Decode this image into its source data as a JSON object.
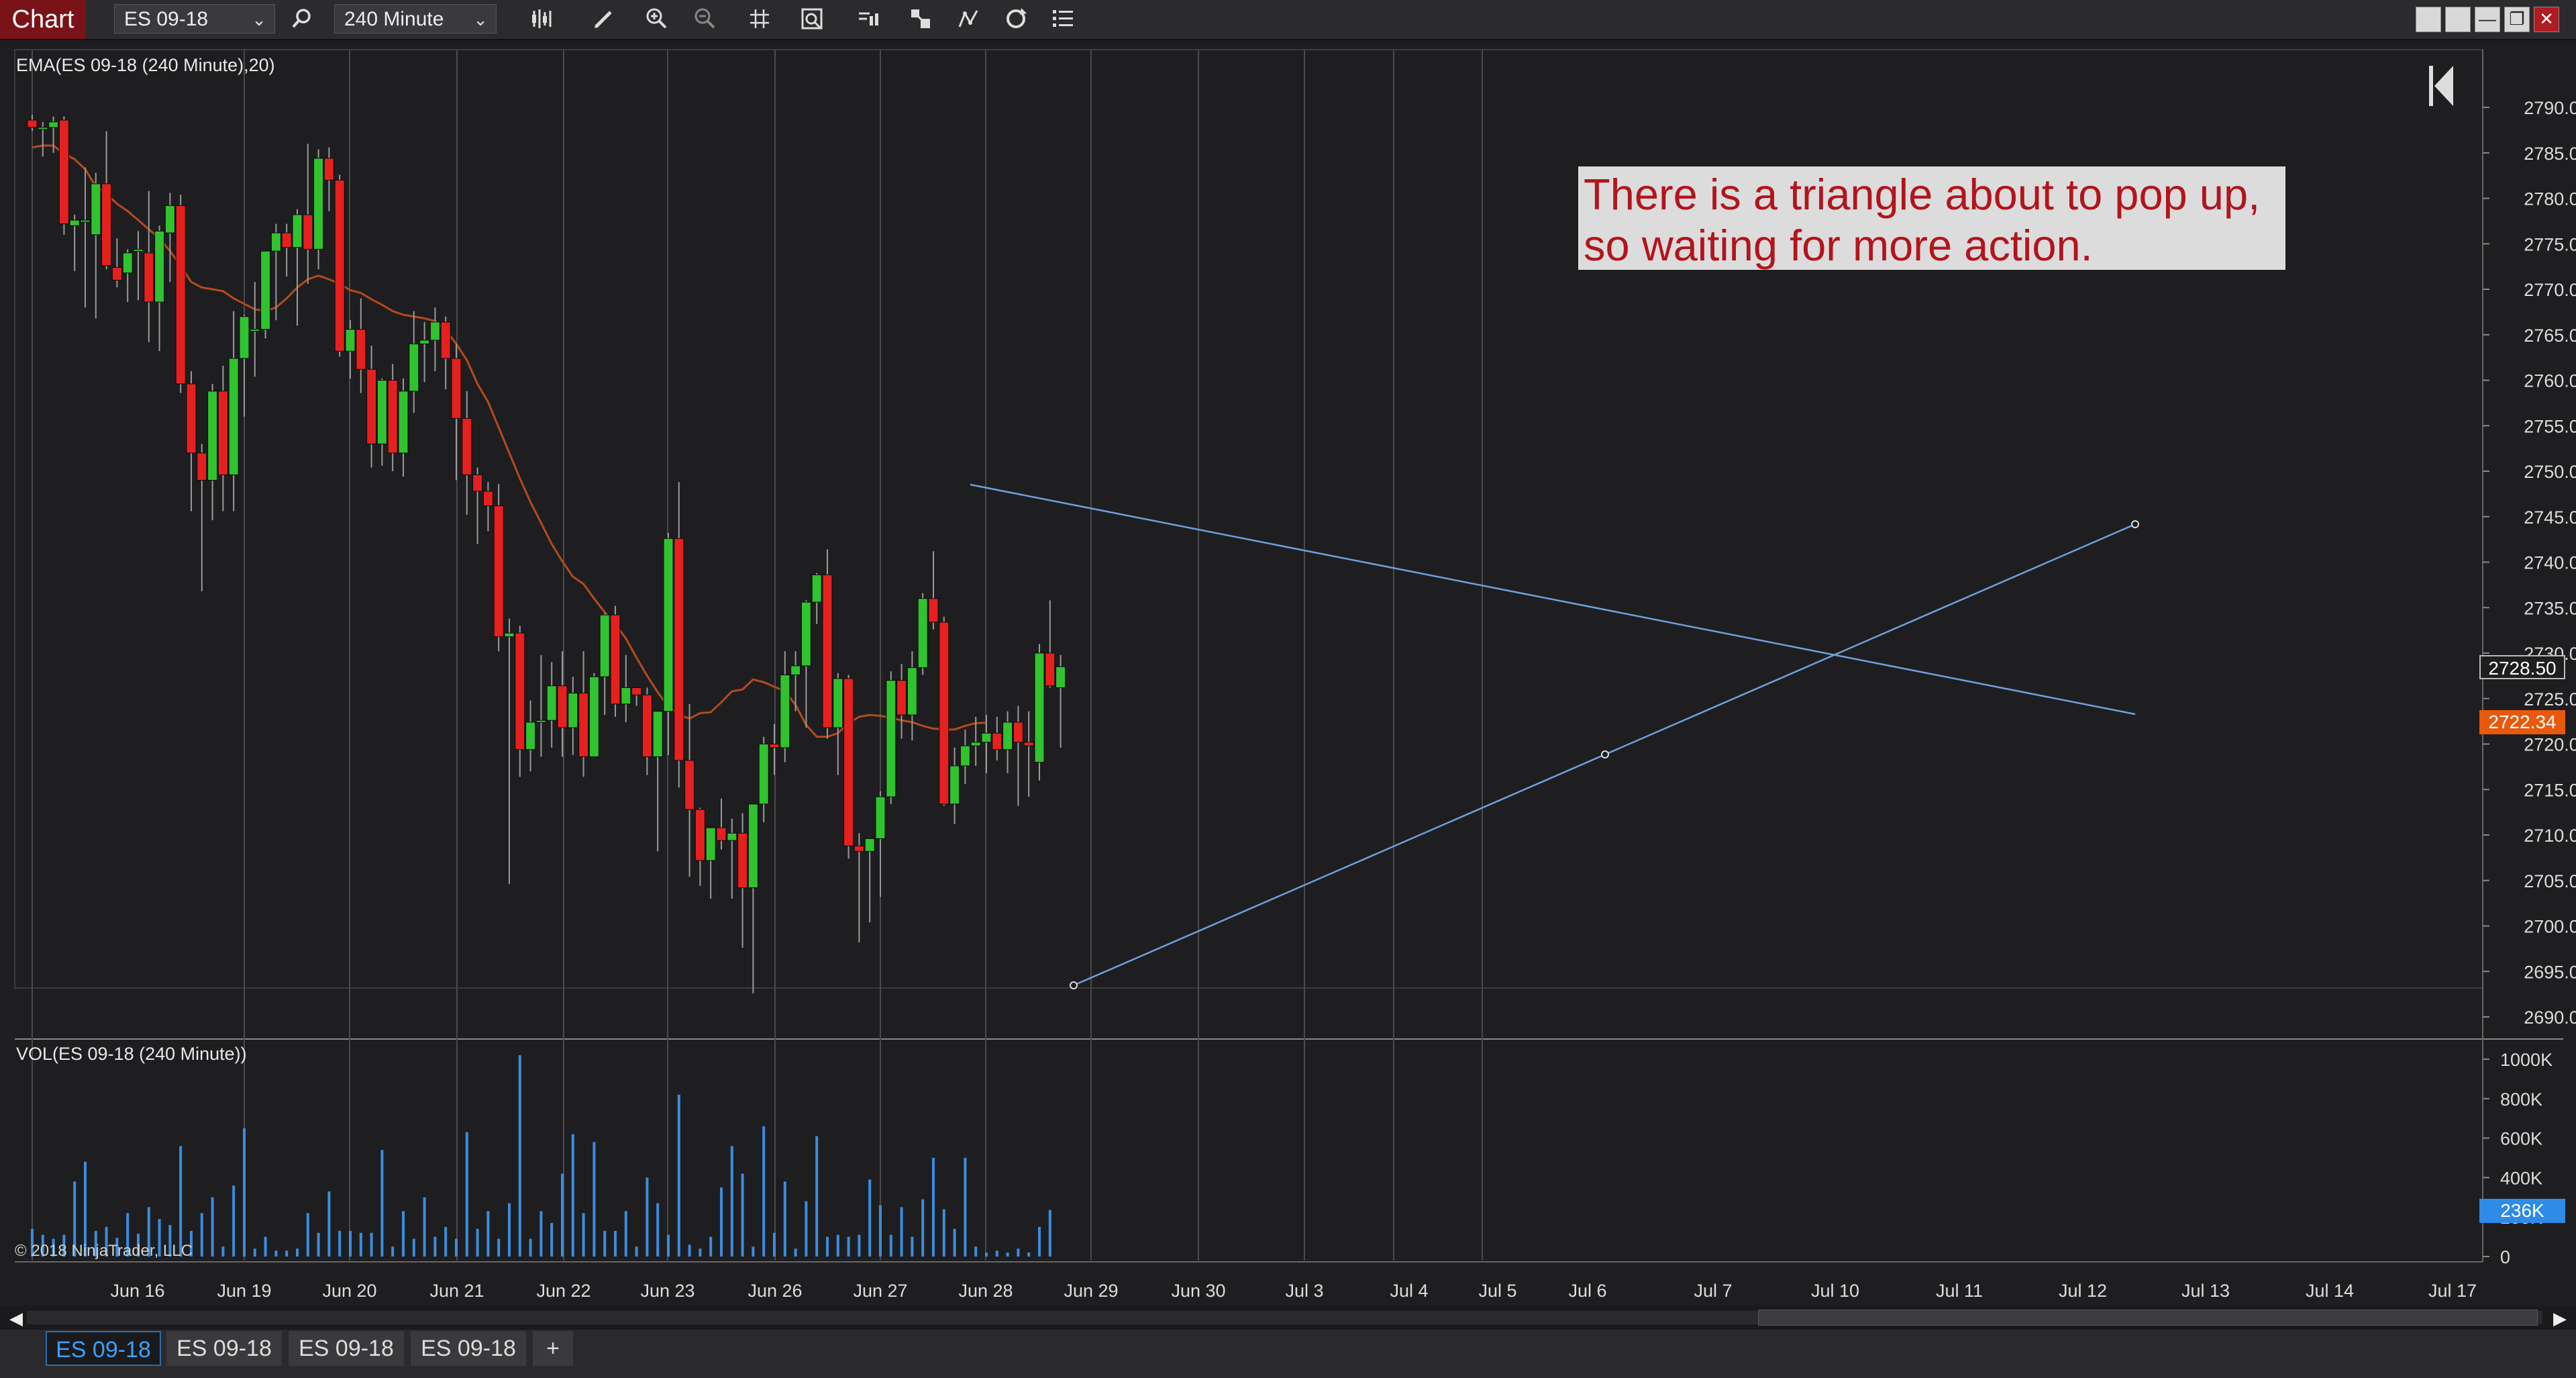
{
  "toolbar": {
    "chart_tab": "Chart",
    "instrument": "ES 09-18",
    "interval": "240 Minute",
    "icons": [
      "search-icon",
      "bar-type-icon",
      "pencil-icon",
      "zoom-in-icon",
      "zoom-out-icon",
      "crosshair-icon",
      "properties-icon",
      "data-box-icon",
      "strategy-icon",
      "indicator-icon",
      "reload-icon",
      "list-icon"
    ],
    "window_buttons": [
      "tile-icon",
      "tile-icon",
      "minimize-icon",
      "restore-icon",
      "close-icon"
    ]
  },
  "indicators": {
    "price_panel": "EMA(ES 09-18 (240 Minute),20)",
    "volume_panel": "VOL(ES 09-18 (240 Minute))"
  },
  "copyright": "© 2018 NinjaTrader, LLC",
  "annotation": {
    "line1": "There is a triangle about to pop up,",
    "line2": "so waiting for more action."
  },
  "colors": {
    "background": "#1e1e20",
    "up": "#2fc32f",
    "down": "#e6201f",
    "ema": "#b34a1e",
    "trendline": "#6fa0de",
    "volume": "#3b8de0",
    "annotation_text": "#b3141c",
    "last_price_tag": "#1e1e20",
    "ema_tag": "#e8590c",
    "volume_tag": "#2e8be6"
  },
  "price_axis": {
    "ticks": [
      "2790.00",
      "2785.00",
      "2780.00",
      "2775.00",
      "2770.00",
      "2765.00",
      "2760.00",
      "2755.00",
      "2750.00",
      "2745.00",
      "2740.00",
      "2735.00",
      "2730.00",
      "2725.00",
      "2720.00",
      "2715.00",
      "2710.00",
      "2705.00",
      "2700.00",
      "2695.00",
      "2690.00"
    ],
    "last_price": "2728.50",
    "ema_value": "2722.34"
  },
  "volume_axis": {
    "ticks": [
      "1000K",
      "800K",
      "600K",
      "400K",
      "200K",
      "0"
    ],
    "last_volume": "236K"
  },
  "date_axis": [
    "Jun 16",
    "Jun 19",
    "Jun 20",
    "Jun 21",
    "Jun 22",
    "Jun 23",
    "Jun 26",
    "Jun 27",
    "Jun 28",
    "Jun 29",
    "Jun 30",
    "Jul 3",
    "Jul 4",
    "Jul 5",
    "Jul 6",
    "Jul 7",
    "Jul 10",
    "Jul 11",
    "Jul 12",
    "Jul 13",
    "Jul 14",
    "Jul 17"
  ],
  "tabs": [
    "ES 09-18",
    "ES 09-18",
    "ES 09-18",
    "ES 09-18"
  ],
  "add_tab": "+",
  "chart_data": {
    "type": "candlestick",
    "ylim": [
      2688,
      2794
    ],
    "ohlc": [
      [
        2788.6,
        2789.2,
        2787.4,
        2787.8
      ],
      [
        2787.6,
        2788.4,
        2784.6,
        2787.8
      ],
      [
        2787.8,
        2789.0,
        2785.0,
        2788.4
      ],
      [
        2788.6,
        2789.0,
        2776.0,
        2777.2
      ],
      [
        2777.0,
        2778.2,
        2772.0,
        2777.6
      ],
      [
        2777.4,
        2783.4,
        2768.0,
        2777.6
      ],
      [
        2776.0,
        2782.8,
        2766.8,
        2781.6
      ],
      [
        2781.6,
        2787.4,
        2772.2,
        2772.6
      ],
      [
        2772.4,
        2775.6,
        2770.2,
        2771.0
      ],
      [
        2771.8,
        2774.4,
        2768.6,
        2774.0
      ],
      [
        2774.4,
        2776.4,
        2768.8,
        2774.4
      ],
      [
        2774.0,
        2780.8,
        2764.2,
        2768.6
      ],
      [
        2768.6,
        2777.0,
        2763.2,
        2776.4
      ],
      [
        2776.2,
        2780.6,
        2770.8,
        2779.2
      ],
      [
        2779.2,
        2780.4,
        2758.6,
        2759.6
      ],
      [
        2759.6,
        2761.0,
        2745.6,
        2752.0
      ],
      [
        2752.0,
        2753.0,
        2736.8,
        2749.0
      ],
      [
        2749.0,
        2759.6,
        2744.6,
        2758.8
      ],
      [
        2758.8,
        2761.6,
        2745.6,
        2749.6
      ],
      [
        2749.6,
        2767.6,
        2745.6,
        2762.4
      ],
      [
        2762.4,
        2767.2,
        2756.0,
        2767.0
      ],
      [
        2765.4,
        2770.8,
        2760.4,
        2765.6
      ],
      [
        2765.6,
        2774.2,
        2764.6,
        2774.2
      ],
      [
        2774.2,
        2777.2,
        2766.6,
        2776.2
      ],
      [
        2776.2,
        2777.2,
        2771.4,
        2774.6
      ],
      [
        2774.6,
        2778.8,
        2766.0,
        2778.2
      ],
      [
        2778.2,
        2786.0,
        2770.6,
        2774.4
      ],
      [
        2774.4,
        2785.4,
        2772.2,
        2784.4
      ],
      [
        2784.4,
        2785.6,
        2778.6,
        2782.0
      ],
      [
        2782.0,
        2782.6,
        2762.6,
        2763.2
      ],
      [
        2763.2,
        2766.6,
        2760.2,
        2765.6
      ],
      [
        2765.6,
        2769.0,
        2758.6,
        2761.2
      ],
      [
        2761.2,
        2763.8,
        2750.4,
        2753.0
      ],
      [
        2753.0,
        2760.2,
        2750.6,
        2760.0
      ],
      [
        2760.0,
        2761.8,
        2750.0,
        2752.0
      ],
      [
        2752.0,
        2760.2,
        2749.4,
        2758.8
      ],
      [
        2758.8,
        2767.6,
        2756.4,
        2764.0
      ],
      [
        2764.0,
        2766.4,
        2759.8,
        2764.4
      ],
      [
        2764.4,
        2768.0,
        2761.0,
        2766.4
      ],
      [
        2766.4,
        2767.0,
        2759.0,
        2762.4
      ],
      [
        2762.4,
        2764.0,
        2749.0,
        2755.8
      ],
      [
        2755.8,
        2758.8,
        2745.2,
        2749.6
      ],
      [
        2749.6,
        2750.4,
        2742.0,
        2747.8
      ],
      [
        2747.8,
        2748.8,
        2743.4,
        2746.2
      ],
      [
        2746.2,
        2748.6,
        2730.2,
        2731.8
      ],
      [
        2731.8,
        2733.8,
        2704.6,
        2732.2
      ],
      [
        2732.2,
        2733.0,
        2716.4,
        2719.4
      ],
      [
        2719.4,
        2724.8,
        2717.0,
        2722.4
      ],
      [
        2722.4,
        2729.8,
        2718.6,
        2722.6
      ],
      [
        2722.6,
        2729.0,
        2719.6,
        2726.4
      ],
      [
        2726.4,
        2730.2,
        2718.6,
        2721.8
      ],
      [
        2721.8,
        2727.4,
        2718.8,
        2725.6
      ],
      [
        2725.6,
        2730.2,
        2716.4,
        2718.6
      ],
      [
        2718.6,
        2727.8,
        2721.4,
        2727.4
      ],
      [
        2727.4,
        2734.4,
        2723.2,
        2734.2
      ],
      [
        2734.2,
        2735.2,
        2723.0,
        2724.4
      ],
      [
        2724.4,
        2729.8,
        2722.4,
        2726.2
      ],
      [
        2726.2,
        2726.2,
        2724.2,
        2725.4
      ],
      [
        2725.4,
        2726.2,
        2716.6,
        2718.6
      ],
      [
        2718.6,
        2720.6,
        2708.2,
        2723.6
      ],
      [
        2723.6,
        2743.2,
        2718.8,
        2742.6
      ],
      [
        2742.6,
        2748.8,
        2715.2,
        2718.2
      ],
      [
        2718.2,
        2724.4,
        2705.4,
        2712.8
      ],
      [
        2712.8,
        2713.0,
        2704.4,
        2707.2
      ],
      [
        2707.2,
        2710.8,
        2703.0,
        2710.8
      ],
      [
        2710.8,
        2714.0,
        2708.4,
        2709.4
      ],
      [
        2709.4,
        2711.8,
        2703.0,
        2710.2
      ],
      [
        2710.2,
        2712.4,
        2697.6,
        2704.2
      ],
      [
        2704.2,
        2705.8,
        2692.6,
        2713.4
      ],
      [
        2713.4,
        2720.8,
        2711.4,
        2720.0
      ],
      [
        2720.0,
        2722.2,
        2716.6,
        2719.6
      ],
      [
        2719.6,
        2730.2,
        2718.0,
        2727.6
      ],
      [
        2727.6,
        2730.2,
        2723.6,
        2728.6
      ],
      [
        2728.6,
        2735.8,
        2721.8,
        2735.6
      ],
      [
        2735.6,
        2738.8,
        2733.2,
        2738.6
      ],
      [
        2738.6,
        2741.4,
        2720.6,
        2721.8
      ],
      [
        2721.8,
        2727.8,
        2716.6,
        2727.2
      ],
      [
        2727.2,
        2727.6,
        2707.4,
        2708.8
      ],
      [
        2708.8,
        2710.2,
        2698.2,
        2708.2
      ],
      [
        2708.2,
        2708.6,
        2700.4,
        2709.6
      ],
      [
        2709.6,
        2714.8,
        2703.2,
        2714.2
      ],
      [
        2714.2,
        2728.0,
        2713.4,
        2727.0
      ],
      [
        2727.0,
        2728.8,
        2720.6,
        2723.2
      ],
      [
        2723.2,
        2730.2,
        2720.4,
        2728.4
      ],
      [
        2728.4,
        2736.6,
        2727.6,
        2736.0
      ],
      [
        2736.0,
        2741.2,
        2732.6,
        2733.4
      ],
      [
        2733.4,
        2734.0,
        2713.2,
        2713.4
      ],
      [
        2713.4,
        2719.6,
        2711.2,
        2717.6
      ],
      [
        2717.6,
        2721.6,
        2715.6,
        2719.8
      ],
      [
        2719.8,
        2723.0,
        2717.6,
        2720.2
      ],
      [
        2720.2,
        2723.2,
        2716.8,
        2721.2
      ],
      [
        2721.2,
        2723.0,
        2718.2,
        2719.4
      ],
      [
        2719.4,
        2723.6,
        2716.8,
        2722.4
      ],
      [
        2722.4,
        2724.2,
        2713.2,
        2720.2
      ],
      [
        2720.2,
        2723.6,
        2714.2,
        2719.8
      ],
      [
        2718.0,
        2731.0,
        2716.0,
        2730.0
      ],
      [
        2730.0,
        2735.8,
        2726.2,
        2726.4
      ],
      [
        2726.2,
        2729.8,
        2719.6,
        2728.5
      ]
    ],
    "volume_k": [
      140,
      110,
      90,
      110,
      380,
      480,
      130,
      150,
      95,
      220,
      115,
      250,
      190,
      160,
      560,
      130,
      220,
      300,
      50,
      360,
      650,
      40,
      100,
      30,
      30,
      40,
      220,
      120,
      330,
      130,
      130,
      120,
      120,
      540,
      50,
      230,
      90,
      300,
      100,
      150,
      90,
      630,
      140,
      230,
      90,
      270,
      1020,
      90,
      230,
      170,
      420,
      620,
      220,
      580,
      130,
      130,
      230,
      50,
      400,
      270,
      110,
      820,
      60,
      40,
      100,
      350,
      560,
      420,
      50,
      660,
      120,
      380,
      40,
      280,
      610,
      100,
      110,
      100,
      110,
      390,
      260,
      110,
      250,
      100,
      290,
      500,
      240,
      140,
      500,
      50,
      20,
      30,
      20,
      40,
      20,
      150,
      236
    ],
    "ema_20": [
      2785.6,
      2785.8,
      2785.8,
      2784.9,
      2784.3,
      2783.2,
      2781.3,
      2780.5,
      2779.4,
      2778.6,
      2777.6,
      2776.6,
      2775.6,
      2774.2,
      2772.6,
      2770.8,
      2770.2,
      2770.0,
      2769.8,
      2769.0,
      2768.4,
      2767.8,
      2767.6,
      2768.0,
      2769.0,
      2770.2,
      2771.1,
      2771.5,
      2771.1,
      2770.6,
      2769.9,
      2769.6,
      2768.9,
      2768.3,
      2767.6,
      2767.2,
      2767.0,
      2766.8,
      2766.5,
      2765.5,
      2764.0,
      2762.2,
      2759.6,
      2757.6,
      2754.8,
      2752.0,
      2749.2,
      2746.6,
      2744.3,
      2742.0,
      2740.1,
      2738.4,
      2737.6,
      2736.0,
      2734.5,
      2733.2,
      2731.6,
      2729.5,
      2727.5,
      2725.7,
      2724.1,
      2723.2,
      2722.8,
      2723.4,
      2723.5,
      2724.6,
      2725.8,
      2726.0,
      2727.1,
      2726.8,
      2726.3,
      2725.8,
      2724.3,
      2722.1,
      2720.8,
      2720.8,
      2721.2,
      2722.3,
      2723.0,
      2723.2,
      2723.1,
      2722.9,
      2722.6,
      2722.4,
      2722.0,
      2721.7,
      2721.6,
      2721.6,
      2722.0,
      2722.3,
      2722.34
    ]
  }
}
